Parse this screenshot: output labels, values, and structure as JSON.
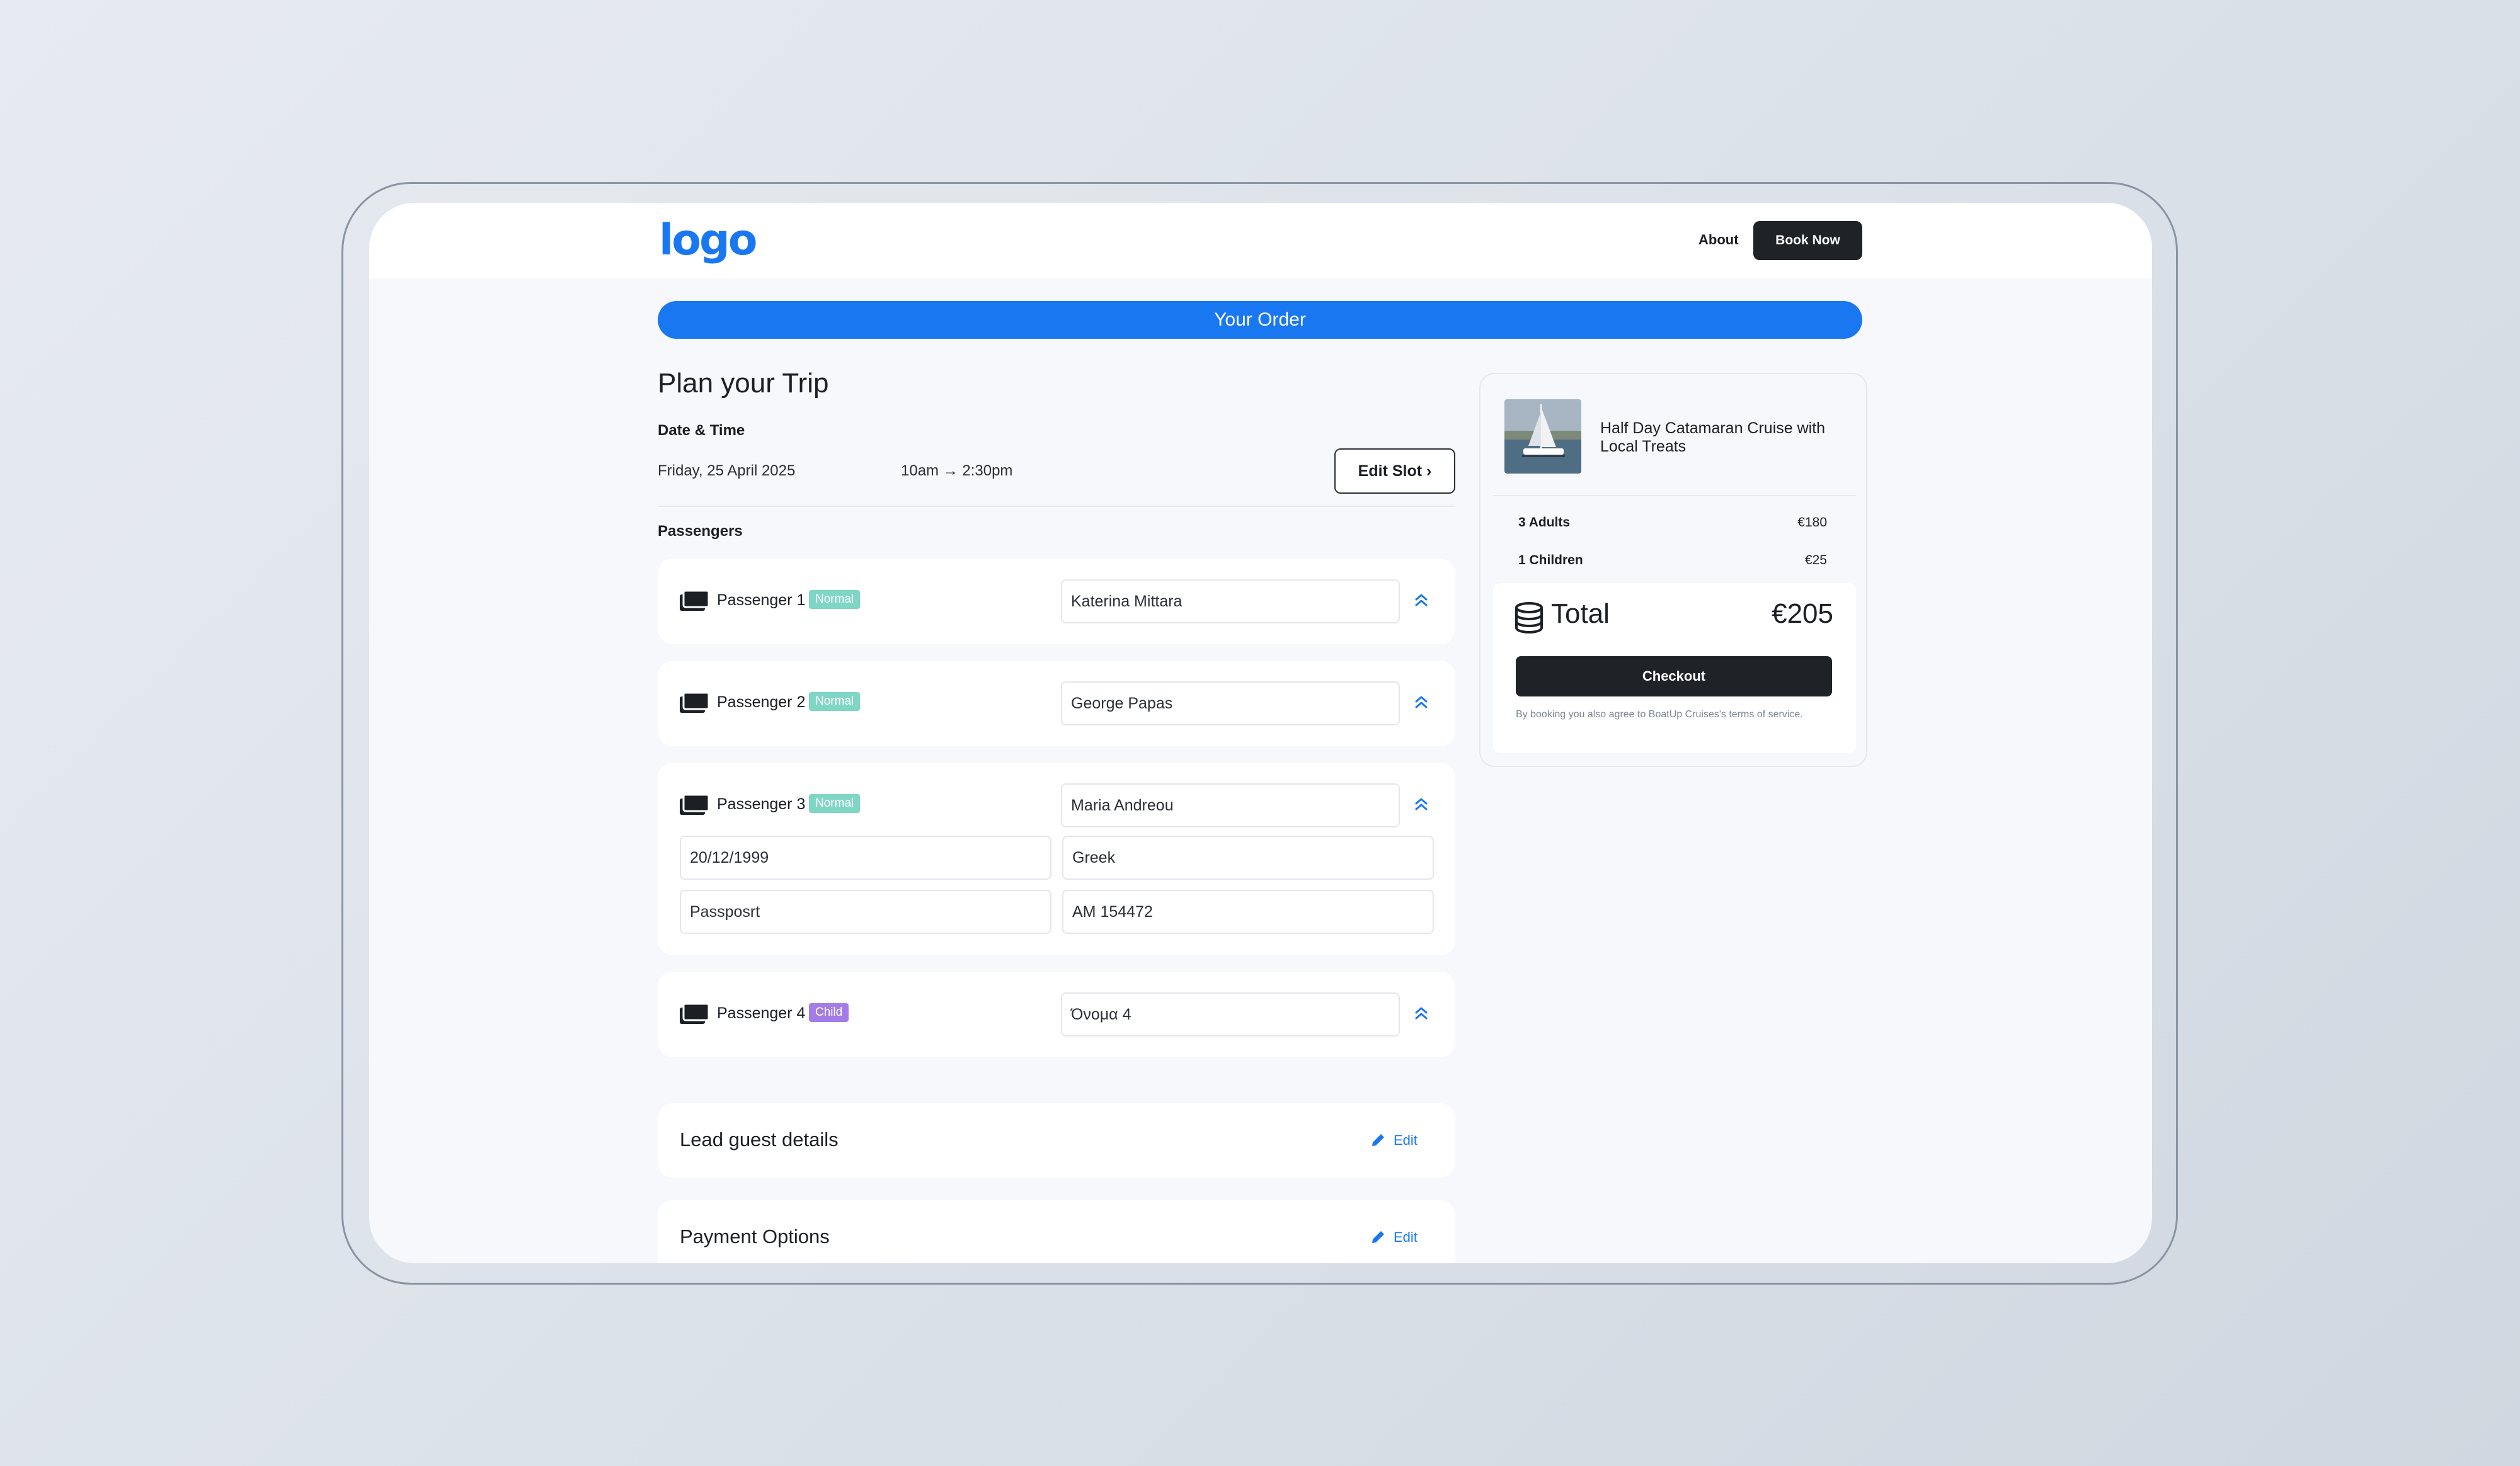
{
  "header": {
    "logo": "logo",
    "nav_about": "About",
    "book_now": "Book Now"
  },
  "order_banner": "Your Order",
  "plan": {
    "title": "Plan your Trip",
    "date_time_label": "Date & Time",
    "date": "Friday, 25 April 2025",
    "time": "10am → 2:30pm",
    "edit_slot": "Edit Slot ›",
    "passengers_label": "Passengers"
  },
  "passengers": [
    {
      "label": "Passenger 1",
      "badge": "Normal",
      "name": "Katerina Mittara"
    },
    {
      "label": "Passenger 2",
      "badge": "Normal",
      "name": "George Papas"
    },
    {
      "label": "Passenger 3",
      "badge": "Normal",
      "name": "Maria Andreou",
      "dob": "20/12/1999",
      "nationality": "Greek",
      "doc_type": "Passposrt",
      "doc_number": "AM 154472"
    },
    {
      "label": "Passenger 4",
      "badge": "Child",
      "name": "Όνομα 4"
    }
  ],
  "lead_guest": {
    "title": "Lead guest details",
    "edit": "Edit"
  },
  "payment": {
    "title": "Payment Options",
    "edit": "Edit"
  },
  "summary": {
    "trip_name": "Half Day Catamaran Cruise with Local Treats",
    "lines": [
      {
        "label": "3 Adults",
        "price": "€180"
      },
      {
        "label": "1 Children",
        "price": "€25"
      }
    ],
    "total_label": "Total",
    "total_amount": "€205",
    "checkout": "Checkout",
    "terms": "By booking you also agree to BoatUp Cruises's terms of service."
  },
  "colors": {
    "brand_blue": "#1a77f2",
    "dark_button": "#1f2227",
    "badge_normal": "#7fd6c4",
    "badge_child": "#a47ce6"
  },
  "icons": {
    "passenger": "ticket-icon",
    "collapse": "chevron-double-up-icon",
    "edit": "pencil-icon",
    "total": "coins-icon"
  }
}
